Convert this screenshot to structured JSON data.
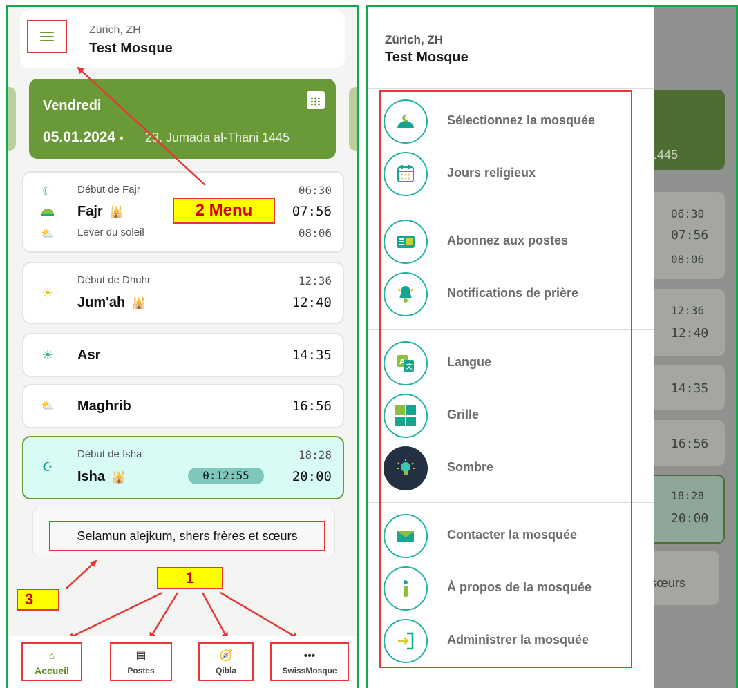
{
  "header": {
    "city": "Zürich, ZH",
    "mosque": "Test Mosque"
  },
  "date_card": {
    "weekday": "Vendredi",
    "date": "05.01.2024",
    "separator": "•",
    "hijri": "23. Jumada al-Thani 1445"
  },
  "prayers": {
    "fajr": {
      "begin_label": "Début de Fajr",
      "begin_time": "06:30",
      "name": "Fajr",
      "time": "07:56",
      "sunrise_label": "Lever du soleil",
      "sunrise_time": "08:06"
    },
    "dhuhr": {
      "begin_label": "Début de Dhuhr",
      "begin_time": "12:36",
      "name": "Jum'ah",
      "time": "12:40"
    },
    "asr": {
      "name": "Asr",
      "time": "14:35"
    },
    "maghrib": {
      "name": "Maghrib",
      "time": "16:56"
    },
    "isha": {
      "begin_label": "Début de Isha",
      "begin_time": "18:28",
      "name": "Isha",
      "countdown": "0:12:55",
      "time": "20:00"
    }
  },
  "greeting": "Selamun alejkum, shers frères et sœurs",
  "bottom_nav": [
    {
      "label": "Accueil",
      "icon": "home-icon"
    },
    {
      "label": "Postes",
      "icon": "document-icon"
    },
    {
      "label": "Qibla",
      "icon": "compass-icon"
    },
    {
      "label": "SwissMosque",
      "icon": "more-icon"
    }
  ],
  "annotations": {
    "menu": "2 Menu",
    "nav": "1",
    "greeting": "3"
  },
  "drawer": {
    "city": "Zürich, ZH",
    "mosque": "Test Mosque",
    "items": [
      {
        "label": "Sélectionnez la mosquée",
        "icon": "mosque-icon"
      },
      {
        "label": "Jours religieux",
        "icon": "calendar-icon"
      },
      {
        "label": "Abonnez aux postes",
        "icon": "news-icon"
      },
      {
        "label": "Notifications de prière",
        "icon": "bell-icon"
      },
      {
        "label": "Langue",
        "icon": "translate-icon"
      },
      {
        "label": "Grille",
        "icon": "grid-icon"
      },
      {
        "label": "Sombre",
        "icon": "bulb-icon"
      },
      {
        "label": "Contacter la mosquée",
        "icon": "mail-icon"
      },
      {
        "label": "À propos de la mosquée",
        "icon": "info-icon"
      },
      {
        "label": "Administrer la mosquée",
        "icon": "login-icon"
      }
    ]
  },
  "background": {
    "hijri_year": "1445",
    "fajr_begin": "06:30",
    "fajr": "07:56",
    "sunrise": "08:06",
    "dhuhr_begin": "12:36",
    "dhuhr": "12:40",
    "asr": "14:35",
    "maghrib": "16:56",
    "isha_begin": "18:28",
    "isha": "20:00",
    "greeting_tail": "sœurs"
  },
  "colors": {
    "brand_green": "#6a9a38",
    "teal": "#23b3a5",
    "annotation_red": "#e53935",
    "annotation_yellow": "#ffff00",
    "frame_green": "#12a84a"
  }
}
